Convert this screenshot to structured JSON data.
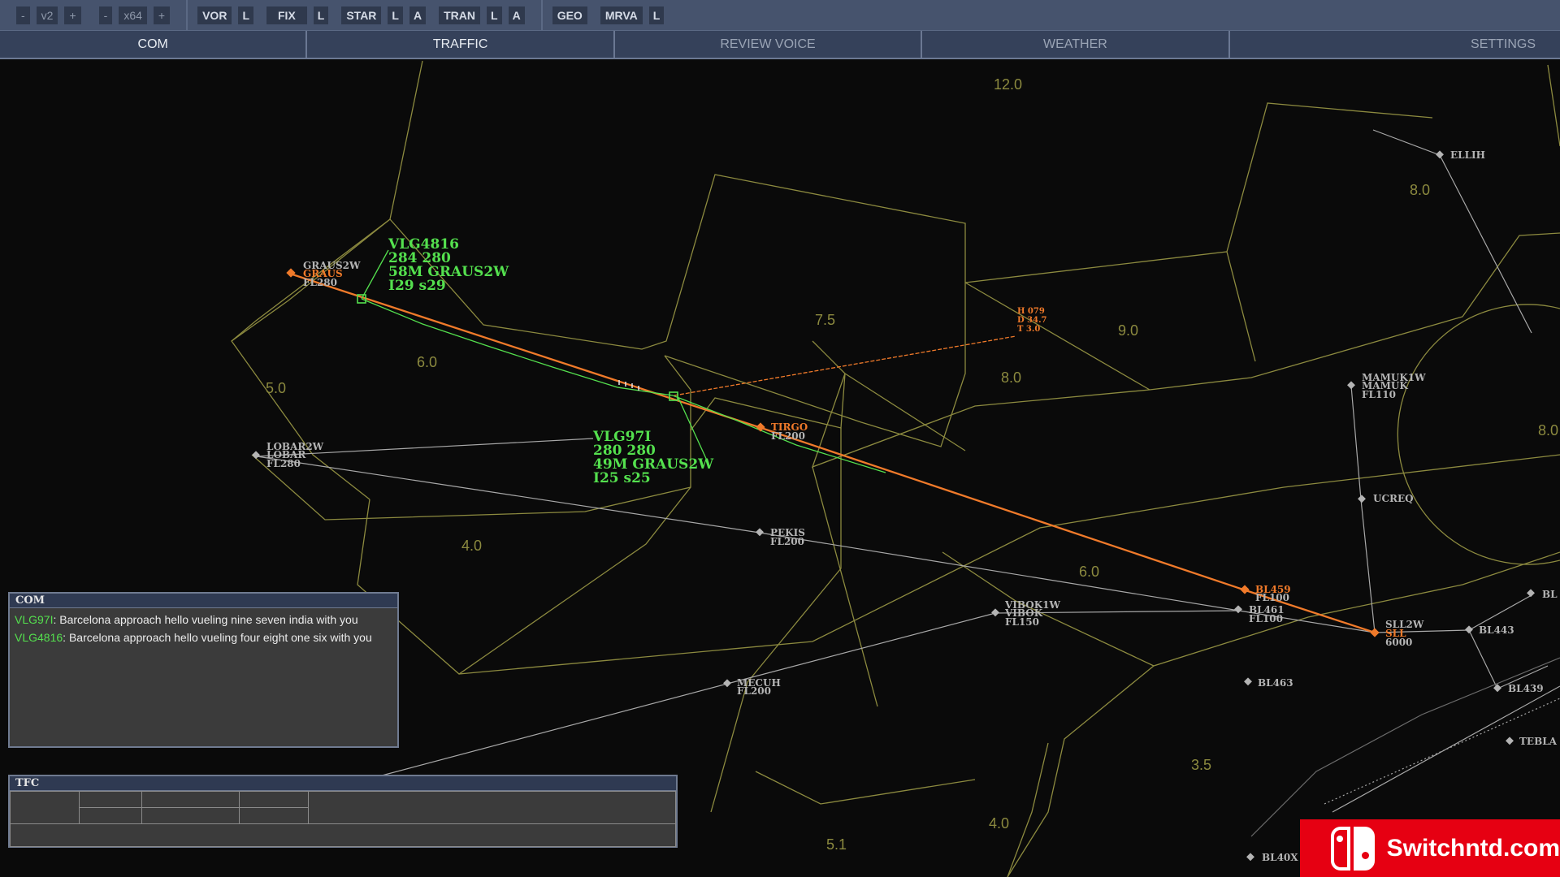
{
  "toolbar": {
    "v_minus": "-",
    "v_value": "v2",
    "v_plus": "+",
    "x_minus": "-",
    "x_value": "x64",
    "x_plus": "+",
    "vor": "VOR",
    "vor_l": "L",
    "fix": "FIX",
    "fix_l": "L",
    "star": "STAR",
    "star_l": "L",
    "star_a": "A",
    "tran": "TRAN",
    "tran_l": "L",
    "tran_a": "A",
    "geo": "GEO",
    "mrva": "MRVA",
    "mrva_l": "L"
  },
  "tabs": [
    "COM",
    "TRAFFIC",
    "REVIEW VOICE",
    "WEATHER",
    "SETTINGS"
  ],
  "sector_labels": [
    "12.0",
    "8.0",
    "7.5",
    "9.0",
    "6.0",
    "5.0",
    "8.0",
    "8.0",
    "4.0",
    "6.0",
    "3.5",
    "4.0",
    "5.1"
  ],
  "waypoints": {
    "graus2w": "GRAUS2W",
    "graus": "GRAUS",
    "graus_fl": "FL280",
    "lobar2w": "LOBAR2W",
    "lobar": "LOBAR",
    "lobar_fl": "FL280",
    "tirgo": "TIRGO",
    "tirgo_fl": "FL200",
    "pekis": "PEKIS",
    "pekis_fl": "FL200",
    "vibok1w": "VIBOK1W",
    "vibok": "VIBOK",
    "vibok_fl": "FL150",
    "mecuh": "MECUH",
    "mecuh_fl": "FL200",
    "bl459": "BL459",
    "bl459_fl": "FL100",
    "bl461": "BL461",
    "bl461_fl": "FL100",
    "sll2w": "SLL2W",
    "sll": "SLL",
    "sll_alt": "6000",
    "bl443": "BL443",
    "bl439": "BL439",
    "bl463": "BL463",
    "mamuk1w": "MAMUK1W",
    "mamuk": "MAMUK",
    "mamuk_fl": "FL110",
    "ucreq": "UCREQ",
    "ellih": "ELLIH",
    "tebla": "TEBLA",
    "bl40x": "BL40X",
    "bl_edge": "BL"
  },
  "measure": {
    "h": "H 079",
    "d": "D 34.7",
    "t": "T 3.0"
  },
  "aircraft": [
    {
      "callsign": "VLG4816",
      "line2": "284 280",
      "line3": "58M GRAUS2W",
      "line4": "I29 s29"
    },
    {
      "callsign": "VLG97I",
      "line2": "280 280",
      "line3": "49M GRAUS2W",
      "line4": "I25 s25"
    }
  ],
  "com": {
    "title": "COM",
    "messages": [
      {
        "callsign": "VLG97I",
        "text": ": Barcelona approach hello vueling nine seven india with you"
      },
      {
        "callsign": "VLG4816",
        "text": ": Barcelona approach hello vueling four eight one six with you"
      }
    ]
  },
  "tfc": {
    "title": "TFC"
  },
  "watermark": {
    "text": "Switchntd.com"
  },
  "colors": {
    "sector": "#8c8a3f",
    "route": "#f07a2a",
    "track": "#54e04e",
    "waypoint": "#b4b4b4",
    "toolbar": "#46536d"
  }
}
